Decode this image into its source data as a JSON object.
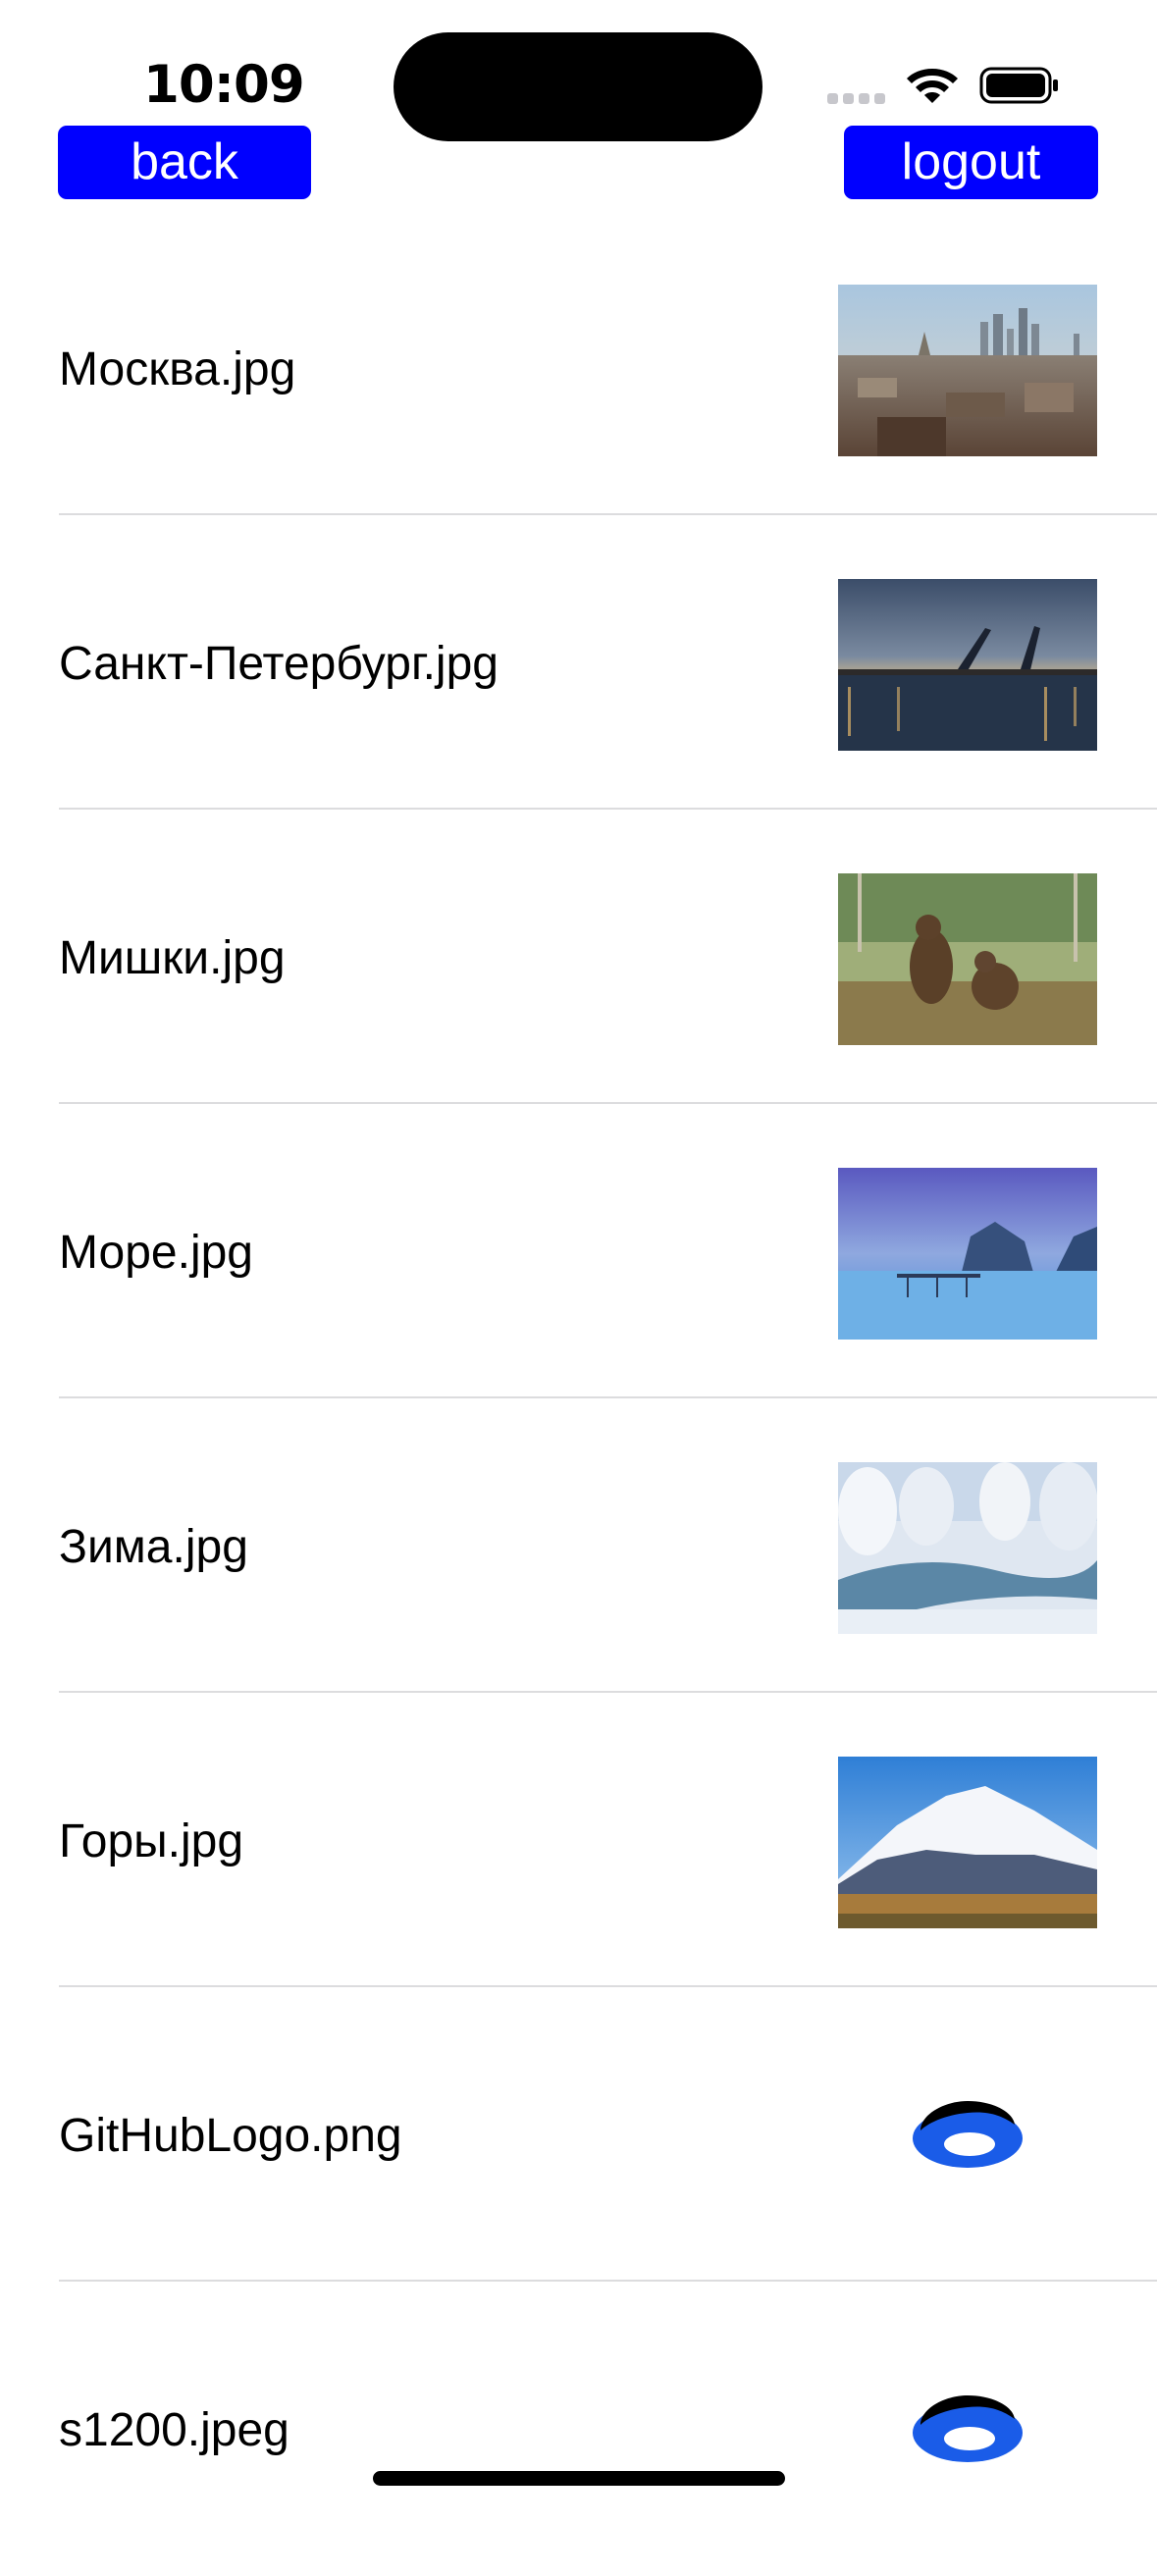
{
  "status_bar": {
    "time": "10:09"
  },
  "nav": {
    "back_label": "back",
    "logout_label": "logout",
    "button_color": "#0000ff"
  },
  "files": [
    {
      "name": "Москва.jpg",
      "preview": "moscow-skyline-photo"
    },
    {
      "name": "Санкт-Петербург.jpg",
      "preview": "saint-petersburg-bridge-photo"
    },
    {
      "name": "Мишки.jpg",
      "preview": "bears-photo"
    },
    {
      "name": "Море.jpg",
      "preview": "sea-pier-photo"
    },
    {
      "name": "Зима.jpg",
      "preview": "winter-river-photo"
    },
    {
      "name": "Горы.jpg",
      "preview": "snowy-mountain-photo"
    },
    {
      "name": "GitHubLogo.png",
      "preview": "yandex-disk-icon"
    },
    {
      "name": "s1200.jpeg",
      "preview": "yandex-disk-icon"
    }
  ]
}
